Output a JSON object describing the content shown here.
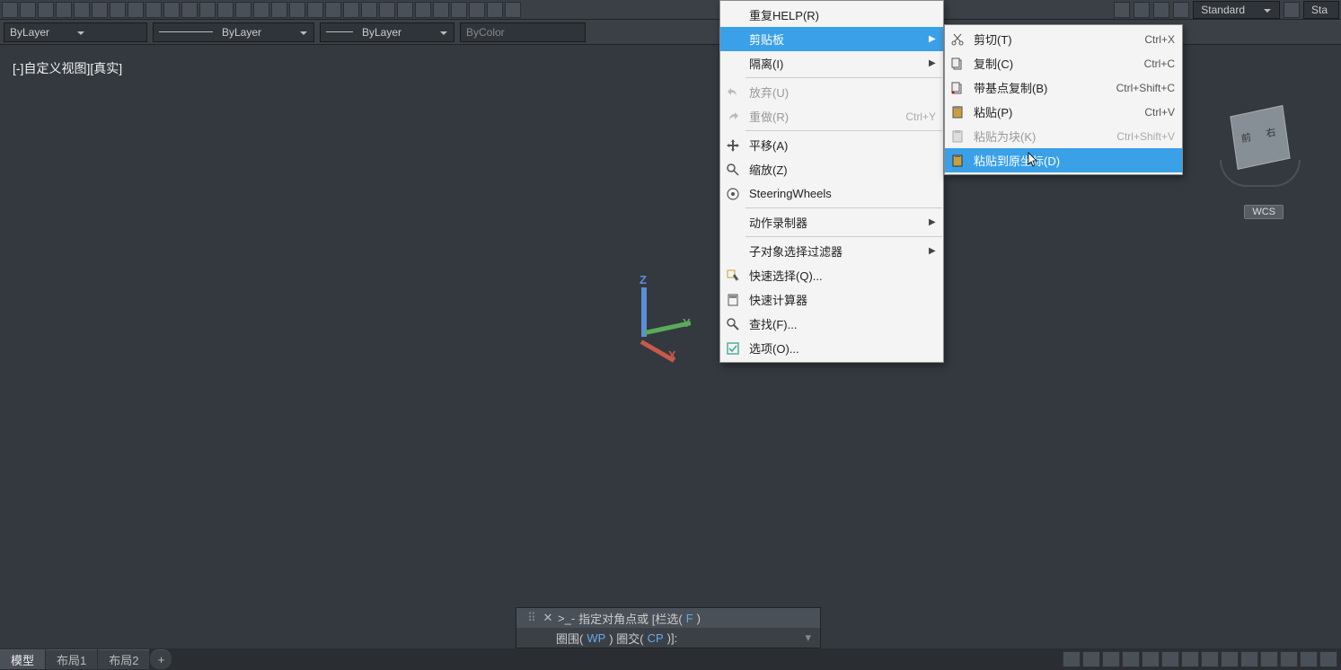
{
  "toolbarLayer": {
    "prop1": "ByLayer",
    "prop2": "ByLayer",
    "prop3": "ByLayer",
    "prop4": "ByColor"
  },
  "style": {
    "name1": "Standard",
    "name2": "Sta"
  },
  "viewport": {
    "label": "[-]自定义视图][真实]",
    "wcs": "WCS",
    "axes": {
      "x": "X",
      "y": "Y",
      "z": "Z"
    }
  },
  "contextMenu": {
    "items": [
      {
        "label": "重复HELP(R)"
      },
      {
        "label": "剪贴板",
        "submenu": true,
        "highlight": true
      },
      {
        "label": "隔离(I)",
        "submenu": true
      },
      {
        "sep": true
      },
      {
        "label": "放弃(U)",
        "disabled": true,
        "icon": "undo"
      },
      {
        "label": "重做(R)",
        "shortcut": "Ctrl+Y",
        "disabled": true,
        "icon": "redo"
      },
      {
        "sep": true
      },
      {
        "label": "平移(A)",
        "icon": "pan"
      },
      {
        "label": "缩放(Z)",
        "icon": "zoom"
      },
      {
        "label": "SteeringWheels",
        "icon": "wheel"
      },
      {
        "sep": true
      },
      {
        "label": "动作录制器",
        "submenu": true
      },
      {
        "sep": true
      },
      {
        "label": "子对象选择过滤器",
        "submenu": true
      },
      {
        "label": "快速选择(Q)...",
        "icon": "qsel"
      },
      {
        "label": "快速计算器",
        "icon": "calc"
      },
      {
        "label": "查找(F)...",
        "icon": "find"
      },
      {
        "label": "选项(O)...",
        "icon": "opts"
      }
    ]
  },
  "submenu": {
    "items": [
      {
        "label": "剪切(T)",
        "shortcut": "Ctrl+X",
        "icon": "cut"
      },
      {
        "label": "复制(C)",
        "shortcut": "Ctrl+C",
        "icon": "copy"
      },
      {
        "label": "带基点复制(B)",
        "shortcut": "Ctrl+Shift+C",
        "icon": "bcopy"
      },
      {
        "label": "粘贴(P)",
        "shortcut": "Ctrl+V",
        "icon": "paste"
      },
      {
        "label": "粘贴为块(K)",
        "shortcut": "Ctrl+Shift+V",
        "icon": "pblock",
        "disabled": true
      },
      {
        "label": "粘贴到原坐标(D)",
        "icon": "porig",
        "highlight": true
      }
    ]
  },
  "command": {
    "line1_prefix": "指定对角点或 [栏选(",
    "line1_kw": "F",
    "line1_suffix": ")",
    "line2_a": "圈围(",
    "line2_wp": "WP",
    "line2_b": ") 圈交(",
    "line2_cp": "CP",
    "line2_c": ")]:",
    "prompt": ">_-"
  },
  "tabs": {
    "t1": "模型",
    "t2": "布局1",
    "t3": "布局2",
    "plus": "+"
  }
}
